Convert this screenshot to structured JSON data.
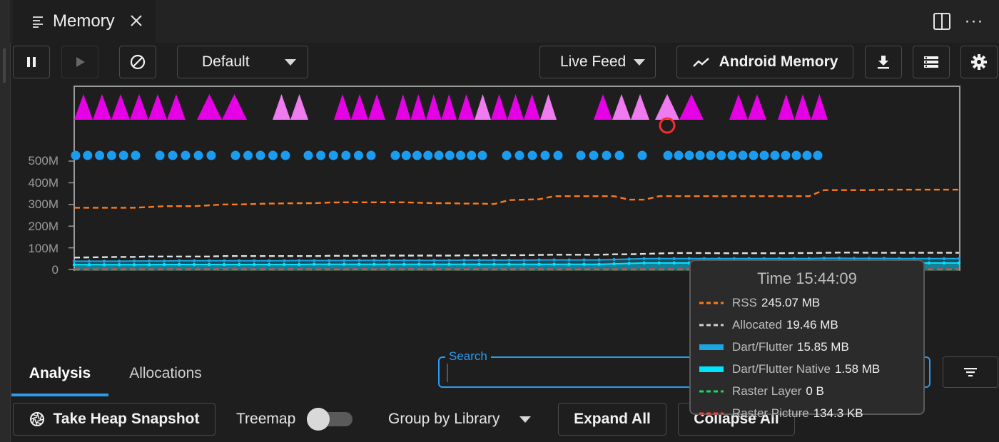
{
  "tab": {
    "title": "Memory",
    "icon": "list-icon",
    "close_icon": "close-icon"
  },
  "title_actions": [
    {
      "icon": "split-view-icon"
    },
    {
      "icon": "more-icon",
      "glyph": "···"
    }
  ],
  "toolbar": {
    "pause_icon": "pause-icon",
    "resume_icon": "play-icon",
    "clear_icon": "block-icon",
    "profile_select": "Default",
    "feed_select": "Live Feed",
    "android_memory_label": "Android Memory",
    "android_memory_icon": "trending-up-icon",
    "export_icon": "download-icon",
    "legend_icon": "legend-list-icon",
    "settings_icon": "gear-icon"
  },
  "chart_data": {
    "type": "line",
    "ylim": [
      0,
      500
    ],
    "y_unit": "MB",
    "y_ticks": [
      "0",
      "100M",
      "200M",
      "300M",
      "400M",
      "500M"
    ],
    "grid": false,
    "event_lanes": [
      {
        "name": "gc-events",
        "marker": "triangle",
        "color": "#e600e6"
      },
      {
        "name": "snapshot-events",
        "marker": "circle",
        "color": "#1a9cf0"
      }
    ],
    "series": [
      {
        "name": "RSS",
        "style": "dashed",
        "color": "#ff7a1a",
        "values": [
          285,
          285,
          285,
          285,
          285,
          288,
          292,
          292,
          292,
          296,
          300,
          300,
          302,
          304,
          305,
          306,
          306,
          309,
          310,
          310,
          310,
          310,
          310,
          308,
          306,
          306,
          304,
          304,
          302,
          320,
          322,
          324,
          338,
          338,
          338,
          338,
          338,
          322,
          322,
          338,
          338,
          338,
          338,
          338,
          338,
          338,
          338,
          338,
          338,
          338,
          366,
          366,
          366,
          366,
          368,
          368,
          368,
          368,
          368,
          368
        ]
      },
      {
        "name": "Allocated",
        "style": "dashed",
        "color": "#e0e0e0",
        "values": [
          55,
          56,
          57,
          58,
          58,
          60,
          60,
          60,
          60,
          60,
          62,
          62,
          62,
          62,
          62,
          62,
          62,
          63,
          63,
          63,
          63,
          64,
          64,
          64,
          64,
          64,
          65,
          65,
          66,
          66,
          66,
          67,
          68,
          68,
          68,
          68,
          70,
          70,
          72,
          74,
          76,
          76,
          76,
          75,
          75,
          75,
          75,
          75,
          76,
          76,
          77,
          78,
          78,
          77,
          77,
          77,
          77,
          77,
          77,
          77
        ]
      },
      {
        "name": "Dart/Flutter",
        "style": "area",
        "color": "#1aa6e0",
        "values": [
          38,
          38,
          38,
          38,
          39,
          39,
          39,
          40,
          40,
          40,
          40,
          40,
          40,
          40,
          40,
          41,
          41,
          41,
          41,
          42,
          42,
          42,
          42,
          42,
          42,
          42,
          43,
          43,
          43,
          43,
          43,
          44,
          44,
          44,
          44,
          44,
          46,
          48,
          50,
          50,
          50,
          50,
          50,
          50,
          50,
          50,
          50,
          50,
          50,
          50,
          52,
          52,
          51,
          51,
          51,
          50,
          50,
          50,
          50,
          50
        ]
      },
      {
        "name": "Dart/Flutter Native",
        "style": "area",
        "color": "#00e5ff",
        "values": [
          22,
          22,
          22,
          22,
          22,
          22,
          23,
          23,
          23,
          23,
          23,
          23,
          23,
          23,
          23,
          23,
          24,
          24,
          24,
          24,
          24,
          24,
          24,
          24,
          24,
          24,
          24,
          24,
          24,
          24,
          24,
          24,
          24,
          24,
          24,
          24,
          26,
          28,
          30,
          30,
          30,
          30,
          30,
          30,
          30,
          30,
          30,
          30,
          30,
          30,
          32,
          32,
          31,
          31,
          31,
          30,
          30,
          30,
          30,
          30
        ]
      },
      {
        "name": "Raster Layer",
        "style": "dashed",
        "color": "#1ed760",
        "values": [
          0,
          0,
          0,
          0,
          0,
          0,
          0,
          0,
          0,
          0,
          0,
          0,
          0,
          0,
          0,
          0,
          0,
          0,
          0,
          0,
          0,
          0,
          0,
          0,
          0,
          0,
          0,
          0,
          0,
          0,
          0,
          0,
          0,
          0,
          0,
          0,
          0,
          0,
          0,
          0,
          0,
          0,
          0,
          0,
          0,
          0,
          0,
          0,
          0,
          0,
          0,
          0,
          0,
          0,
          0,
          0,
          0,
          0,
          0,
          0
        ]
      },
      {
        "name": "Raster Picture",
        "style": "dashed",
        "color": "#ff3b3b",
        "values": [
          1,
          1,
          1,
          1,
          1,
          1,
          1,
          1,
          1,
          1,
          1,
          1,
          1,
          1,
          1,
          1,
          1,
          1,
          1,
          1,
          1,
          1,
          1,
          1,
          1,
          1,
          1,
          1,
          1,
          1,
          1,
          1,
          1,
          1,
          1,
          1,
          1,
          1,
          1,
          1,
          1,
          1,
          1,
          1,
          1,
          1,
          1,
          1,
          1,
          1,
          1,
          1,
          1,
          1,
          1,
          1,
          1,
          1,
          1,
          1
        ]
      }
    ]
  },
  "tooltip": {
    "time": "Time 15:44:09",
    "rows": [
      {
        "name": "RSS",
        "value": "245.07 MB",
        "swatch": "dashed",
        "color": "#ff7a1a"
      },
      {
        "name": "Allocated",
        "value": "19.46 MB",
        "swatch": "dashed",
        "color": "#d0d0d0"
      },
      {
        "name": "Dart/Flutter",
        "value": "15.85 MB",
        "swatch": "solid",
        "color": "#1aa6e0"
      },
      {
        "name": "Dart/Flutter Native",
        "value": "1.58 MB",
        "swatch": "solid",
        "color": "#00e5ff"
      },
      {
        "name": "Raster Layer",
        "value": "0 B",
        "swatch": "dashed",
        "color": "#1ed760"
      },
      {
        "name": "Raster Picture",
        "value": "134.3 KB",
        "swatch": "dashed",
        "color": "#ff3b3b"
      }
    ]
  },
  "analysis_tabs": [
    {
      "label": "Analysis",
      "selected": true
    },
    {
      "label": "Allocations",
      "selected": false
    }
  ],
  "search": {
    "label": "Search",
    "value": ""
  },
  "filter_icon": "filter-icon",
  "bottom_toolbar": {
    "snapshot_label": "Take Heap Snapshot",
    "snapshot_icon": "camera-shutter-icon",
    "treemap_label": "Treemap",
    "treemap_on": false,
    "group_by_select": "Group by Library",
    "expand_all_label": "Expand All",
    "collapse_all_label": "Collapse All"
  }
}
